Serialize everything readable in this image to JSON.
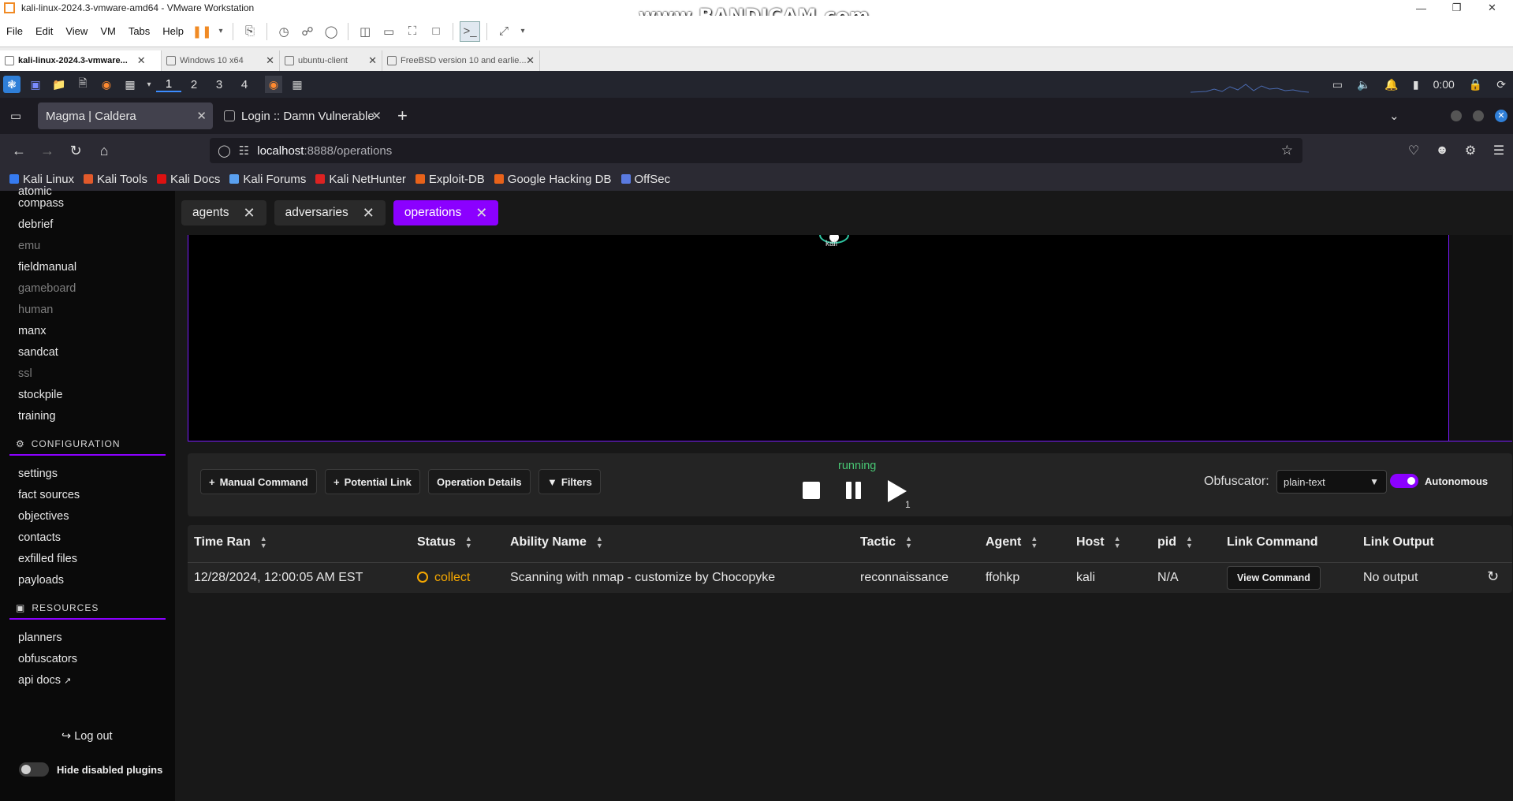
{
  "vm": {
    "title": "kali-linux-2024.3-vmware-amd64 - VMware Workstation",
    "watermark": "www.BANDICAM.com",
    "menu": [
      "File",
      "Edit",
      "View",
      "VM",
      "Tabs",
      "Help"
    ],
    "tabs": [
      {
        "label": "kali-linux-2024.3-vmware...",
        "active": true
      },
      {
        "label": "Windows 10 x64",
        "active": false
      },
      {
        "label": "ubuntu-client",
        "active": false
      },
      {
        "label": "FreeBSD version 10 and earlie...",
        "active": false
      }
    ]
  },
  "kali_panel": {
    "workspaces": [
      "1",
      "2",
      "3",
      "4"
    ],
    "clock": "0:00"
  },
  "firefox": {
    "tabs": [
      {
        "label": "Magma | Caldera",
        "active": true
      },
      {
        "label": "Login :: Damn Vulnerable",
        "active": false
      }
    ],
    "url_host": "localhost",
    "url_path": ":8888/operations",
    "bookmarks": [
      "Kali Linux",
      "Kali Tools",
      "Kali Docs",
      "Kali Forums",
      "Kali NetHunter",
      "Exploit-DB",
      "Google Hacking DB",
      "OffSec"
    ]
  },
  "sidebar": {
    "plugins": [
      {
        "label": "atomic",
        "disabled": false
      },
      {
        "label": "compass",
        "disabled": false
      },
      {
        "label": "debrief",
        "disabled": false
      },
      {
        "label": "emu",
        "disabled": true
      },
      {
        "label": "fieldmanual",
        "disabled": false
      },
      {
        "label": "gameboard",
        "disabled": true
      },
      {
        "label": "human",
        "disabled": true
      },
      {
        "label": "manx",
        "disabled": false
      },
      {
        "label": "sandcat",
        "disabled": false
      },
      {
        "label": "ssl",
        "disabled": true
      },
      {
        "label": "stockpile",
        "disabled": false
      },
      {
        "label": "training",
        "disabled": false
      }
    ],
    "config_head": "CONFIGURATION",
    "config_items": [
      "settings",
      "fact sources",
      "objectives",
      "contacts",
      "exfilled files",
      "payloads"
    ],
    "resources_head": "RESOURCES",
    "resource_items": [
      "planners",
      "obfuscators",
      "api docs"
    ],
    "logout": "Log out",
    "hide_label": "Hide disabled plugins"
  },
  "page_tabs": [
    {
      "label": "agents",
      "active": false
    },
    {
      "label": "adversaries",
      "active": false
    },
    {
      "label": "operations",
      "active": true
    }
  ],
  "graph": {
    "node_label": "kali"
  },
  "controls": {
    "manual_command": "Manual Command",
    "potential_link": "Potential Link",
    "operation_details": "Operation Details",
    "filters": "Filters",
    "state": "running",
    "play_count": "1",
    "obfuscator_label": "Obfuscator:",
    "obfuscator_value": "plain-text",
    "autonomous_label": "Autonomous",
    "autonomous_on": true
  },
  "table": {
    "headers": [
      "Time Ran",
      "Status",
      "Ability Name",
      "Tactic",
      "Agent",
      "Host",
      "pid",
      "Link Command",
      "Link Output"
    ],
    "rows": [
      {
        "time_ran": "12/28/2024, 12:00:05 AM EST",
        "status": "collect",
        "ability_name": "Scanning with nmap - customize by Chocopyke",
        "tactic": "reconnaissance",
        "agent": "ffohkp",
        "host": "kali",
        "pid": "N/A",
        "link_command_button": "View Command",
        "link_output": "No output"
      }
    ]
  }
}
